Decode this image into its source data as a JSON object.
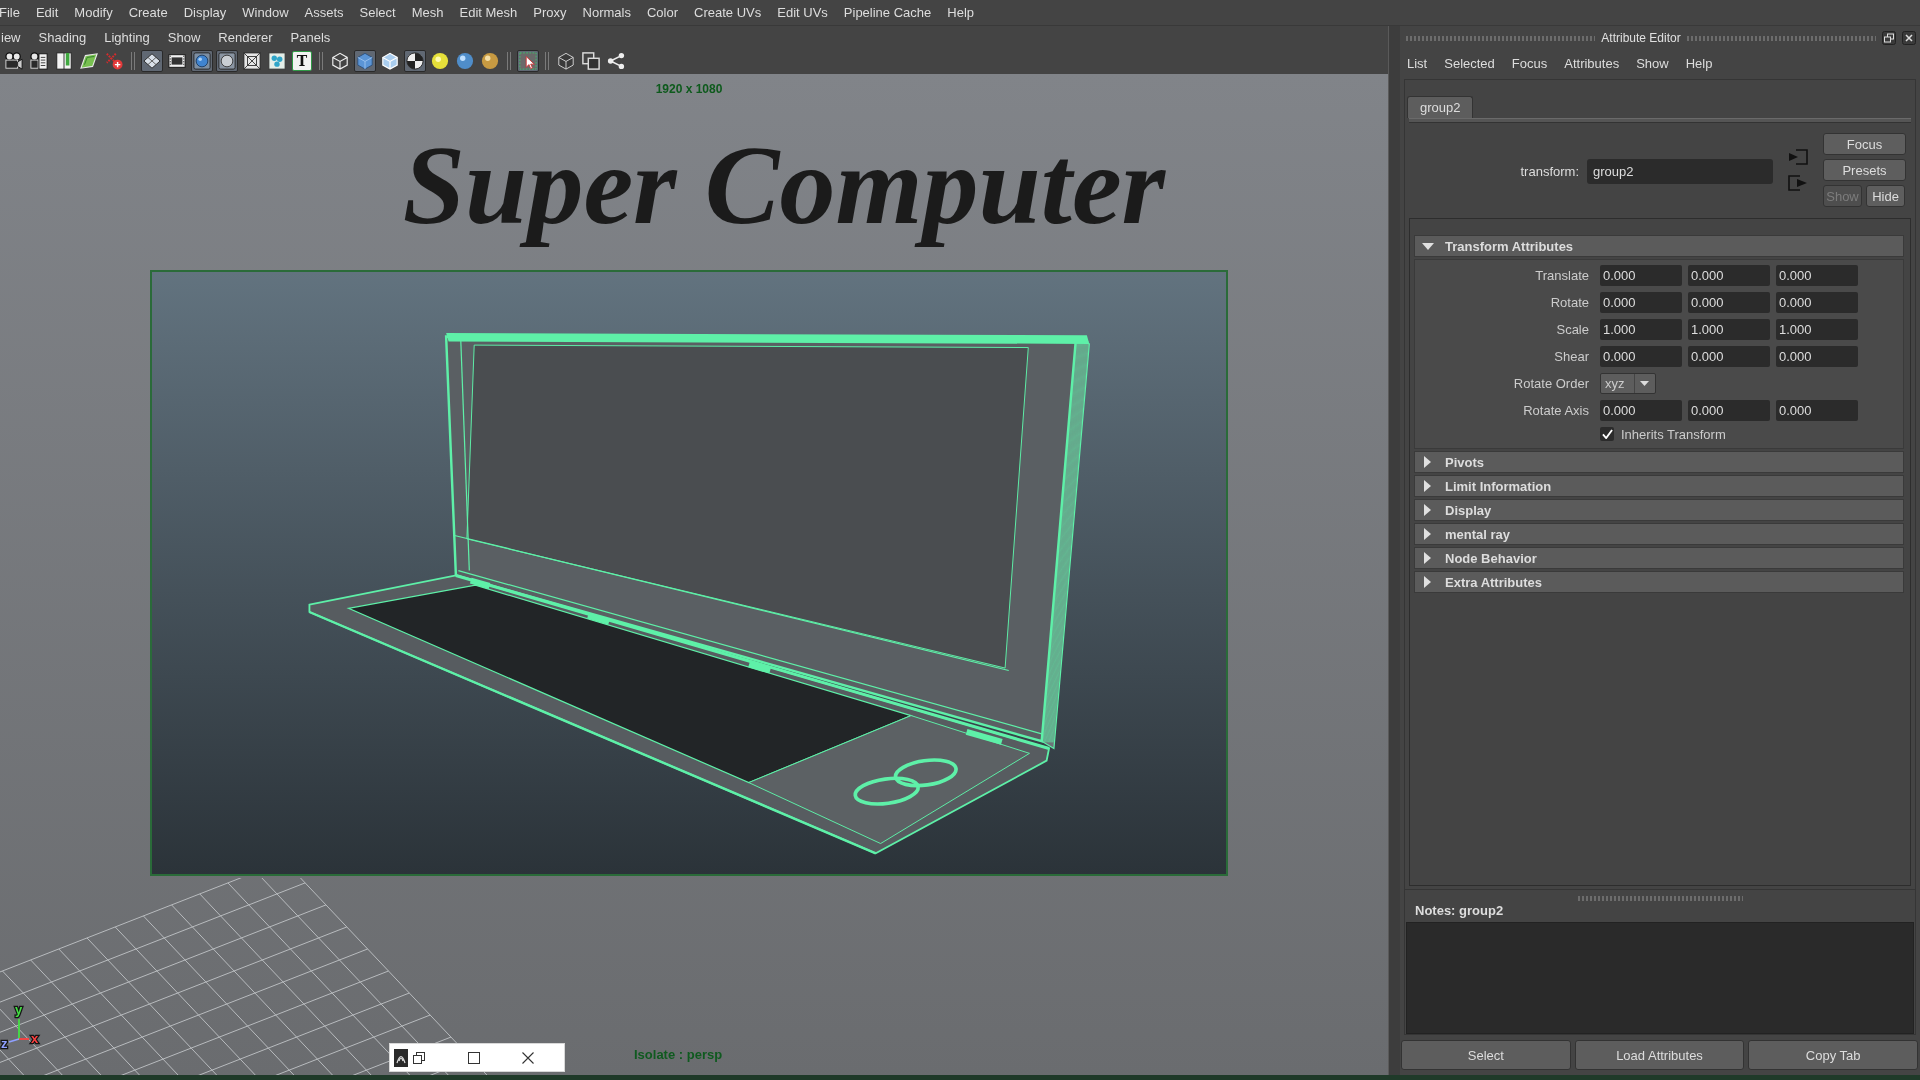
{
  "menu_bar": [
    "File",
    "Edit",
    "Modify",
    "Create",
    "Display",
    "Window",
    "Assets",
    "Select",
    "Mesh",
    "Edit Mesh",
    "Proxy",
    "Normals",
    "Color",
    "Create UVs",
    "Edit UVs",
    "Pipeline Cache",
    "Help"
  ],
  "viewport": {
    "panel_menu": [
      "iew",
      "Shading",
      "Lighting",
      "Show",
      "Renderer",
      "Panels"
    ],
    "toolbar": [
      [
        {
          "on": false
        },
        {
          "on": false
        },
        {
          "on": false
        },
        {
          "on": false
        },
        {
          "on": false
        }
      ],
      [
        {
          "on": true
        },
        {
          "on": false
        },
        {
          "on": true
        },
        {
          "on": true
        },
        {
          "on": false
        },
        {
          "on": false
        },
        {
          "on": false,
          "glyph": "T"
        }
      ],
      [
        {
          "on": false
        },
        {
          "on": true
        },
        {
          "on": false
        },
        {
          "on": true
        },
        {
          "on": false
        },
        {
          "on": false
        },
        {
          "on": false
        }
      ],
      [
        {
          "on": true
        }
      ],
      [
        {
          "on": false
        },
        {
          "on": false
        },
        {
          "on": false
        }
      ]
    ],
    "resolution_label": "1920 x 1080",
    "title": "Super Computer",
    "axis_labels": [
      {
        "label": "y",
        "color": "#44e044"
      },
      {
        "label": "z",
        "color": "#8fa0ff"
      },
      {
        "label": "x",
        "color": "#ff4040"
      }
    ],
    "hud_label": "Isolate : persp"
  },
  "attribute_editor": {
    "title": "Attribute Editor",
    "menu": [
      "List",
      "Selected",
      "Focus",
      "Attributes",
      "Show",
      "Help"
    ],
    "tabs": [
      {
        "label": "group2",
        "selected": true
      }
    ],
    "node_type": "transform:",
    "node_name": "group2",
    "side_buttons": [
      {
        "label": "Focus",
        "disabled": false
      },
      {
        "label": "Presets",
        "disabled": false
      },
      {
        "label": "Show",
        "disabled": true
      },
      {
        "label": "Hide",
        "disabled": false
      }
    ],
    "sections": [
      {
        "title": "Transform Attributes",
        "expanded": true,
        "rows": [
          {
            "kind": "vector",
            "label": "Translate",
            "values": [
              "0.000",
              "0.000",
              "0.000"
            ]
          },
          {
            "kind": "vector",
            "label": "Rotate",
            "values": [
              "0.000",
              "0.000",
              "0.000"
            ]
          },
          {
            "kind": "vector",
            "label": "Scale",
            "values": [
              "1.000",
              "1.000",
              "1.000"
            ]
          },
          {
            "kind": "vector",
            "label": "Shear",
            "values": [
              "0.000",
              "0.000",
              "0.000"
            ]
          },
          {
            "kind": "dropdown",
            "label": "Rotate Order",
            "value": "xyz"
          },
          {
            "kind": "vector",
            "label": "Rotate Axis",
            "values": [
              "0.000",
              "0.000",
              "0.000"
            ]
          },
          {
            "kind": "checkbox",
            "label": "Inherits Transform",
            "checked": true
          }
        ]
      },
      {
        "title": "Pivots",
        "expanded": false
      },
      {
        "title": "Limit Information",
        "expanded": false
      },
      {
        "title": "Display",
        "expanded": false
      },
      {
        "title": "mental ray",
        "expanded": false
      },
      {
        "title": "Node Behavior",
        "expanded": false
      },
      {
        "title": "Extra Attributes",
        "expanded": false
      }
    ],
    "notes_label": "Notes: group2",
    "bottom_buttons": [
      "Select",
      "Load Attributes",
      "Copy Tab"
    ]
  }
}
